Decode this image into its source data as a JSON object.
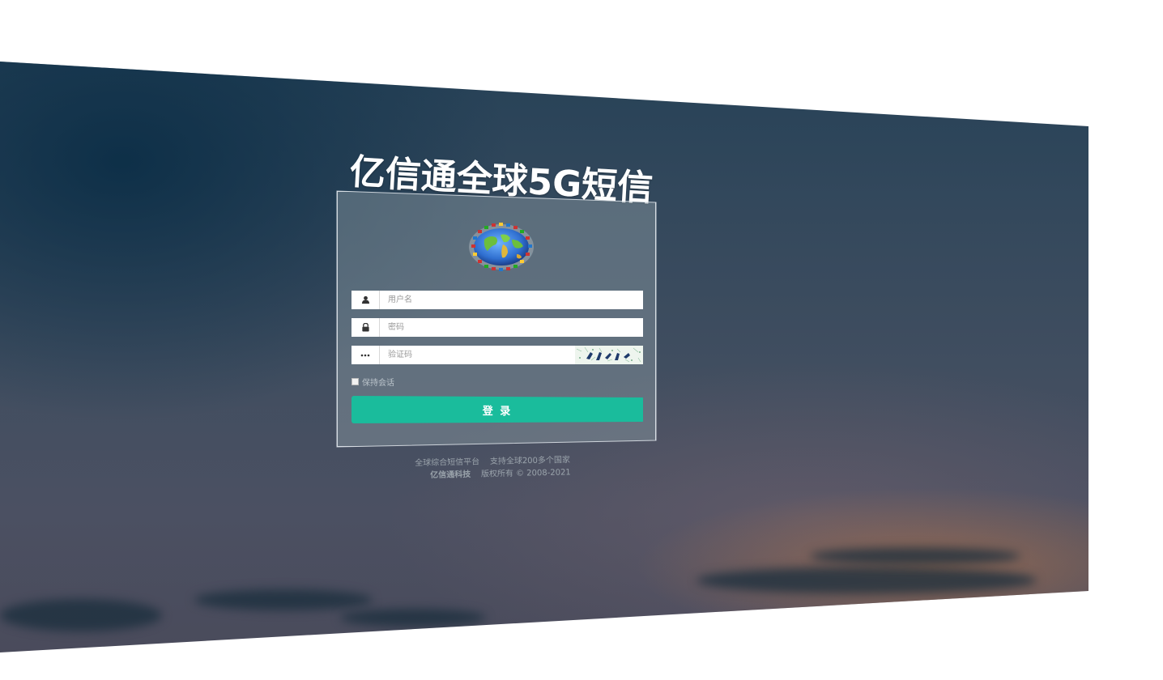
{
  "app_title": "亿信通全球5G短信",
  "login": {
    "username_placeholder": "用户名",
    "password_placeholder": "密码",
    "captcha_placeholder": "验证码",
    "remember_label": "保持会话",
    "submit_label": "登 录"
  },
  "footer": {
    "slogan_1": "全球综合短信平台",
    "slogan_2": "支持全球200多个国家",
    "company": "亿信通科技",
    "copyright": "版权所有 © 2008-2021"
  },
  "icons": {
    "username": "user-icon",
    "password": "lock-icon",
    "captcha": "dots-icon",
    "logo": "globe-logo-icon"
  },
  "colors": {
    "accent": "#1abc9c",
    "title": "#ffffff"
  }
}
